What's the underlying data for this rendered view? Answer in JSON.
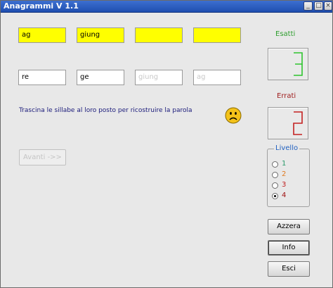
{
  "window": {
    "title": "Anagrammi V 1.1",
    "titlebar_color": "#2a5bc0"
  },
  "target_slots": [
    "ag",
    "giung",
    "",
    ""
  ],
  "source_slots": [
    {
      "text": "re",
      "used": false
    },
    {
      "text": "ge",
      "used": false
    },
    {
      "text": "giung",
      "used": true
    },
    {
      "text": "ag",
      "used": true
    }
  ],
  "instruction": "Trascina le sillabe al loro posto per ricostruire la parola",
  "feedback_icon": "sad-face-icon",
  "next_button": {
    "label": "Avanti ->>",
    "enabled": false
  },
  "score": {
    "correct_label": "Esatti",
    "correct_value": "3",
    "correct_color": "#2e9e2e",
    "wrong_label": "Errati",
    "wrong_value": "2",
    "wrong_color": "#a02020",
    "digit_color": "#2ec42e",
    "digit_color_wrong": "#c42020"
  },
  "level": {
    "title": "Livello",
    "options": [
      {
        "label": "1",
        "color": "#2a9a6a",
        "selected": false
      },
      {
        "label": "2",
        "color": "#e07a20",
        "selected": false
      },
      {
        "label": "3",
        "color": "#c02020",
        "selected": false
      },
      {
        "label": "4",
        "color": "#a01010",
        "selected": true
      }
    ]
  },
  "buttons": {
    "reset": "Azzera",
    "info": "Info",
    "exit": "Esci"
  }
}
